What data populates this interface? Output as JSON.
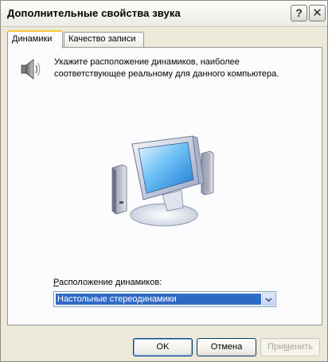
{
  "window": {
    "title": "Дополнительные свойства звука",
    "help_glyph": "?",
    "close_glyph": "✕"
  },
  "tabs": [
    {
      "label": "Динамики",
      "active": true
    },
    {
      "label": "Качество записи",
      "active": false
    }
  ],
  "panel": {
    "description_line1": "Укажите расположение динамиков, наиболее",
    "description_line2": "соответствующее реальному для данного компьютера.",
    "location_label_underlined": "Р",
    "location_label_rest": "асположение динамиков:",
    "location_selected": "Настольные стереодинамики"
  },
  "buttons": {
    "ok": "OK",
    "cancel": "Отмена",
    "apply_underlined": "м",
    "apply_before": "При",
    "apply_after": "енить"
  },
  "colors": {
    "accent_tab": "#ffc83c",
    "selection": "#316ac5",
    "button_border": "#003c74"
  },
  "icons": [
    "help-icon",
    "close-icon",
    "speaker-icon",
    "monitor-speakers-illustration",
    "chevron-down-icon"
  ]
}
